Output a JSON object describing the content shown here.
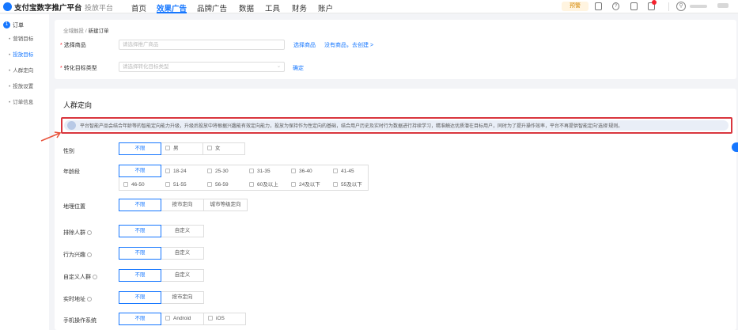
{
  "header": {
    "brand": "支付宝数字推广平台",
    "brand_sub": "投放平台",
    "nav": [
      "首页",
      "效果广告",
      "品牌广告",
      "数据",
      "工具",
      "财务",
      "账户"
    ],
    "active_nav": "效果广告",
    "warn_button": "预警",
    "accent": "#1677ff"
  },
  "sidebar": {
    "step_number": "1",
    "step_title": "订单",
    "items": [
      "营销目标",
      "投放目标",
      "人群定向",
      "投放设置",
      "订单信息"
    ],
    "active_item": "投放目标"
  },
  "breadcrumb": {
    "parent": "全域触投",
    "separator": "/",
    "current": "新建订单"
  },
  "product_form": {
    "product_label": "选择商品",
    "product_placeholder": "请选择推广商品",
    "select_product_link": "选择商品",
    "no_product_link": "没有商品，去创建 >",
    "conversion_label": "转化目标类型",
    "conversion_placeholder": "请选择转化目标类型",
    "conversion_link": "确定"
  },
  "audience": {
    "section_title": "人群定向",
    "notice": "平台智能产品会结合年龄等的智能定向能力升级，升级后投放中将根据兴趣能有效定向能力，投放为保持作为性定向的基础，结合用户历史及实时行为数据进行持续学习，精准触达优质潜在目标用户，同时为了提升操作效率，平台不再提供智能定向'选择'规则。",
    "gender": {
      "label": "性别",
      "options": [
        "不限",
        "男",
        "女"
      ],
      "selected": "不限"
    },
    "age": {
      "label": "年龄段",
      "unlimited": "不限",
      "options": [
        "18-24",
        "25-30",
        "31-35",
        "36-40",
        "41-45",
        "46-50",
        "51-55",
        "56-59",
        "60及以上",
        "24及以下",
        "55及以下"
      ],
      "selected": "不限"
    },
    "region": {
      "label": "地理位置",
      "options": [
        "不限",
        "按市定向",
        "城市等级定向"
      ],
      "selected": "不限"
    },
    "exclude": {
      "label": "排除人群",
      "options": [
        "不限",
        "自定义"
      ],
      "selected": "不限"
    },
    "interest": {
      "label": "行为兴趣",
      "options": [
        "不限",
        "自定义"
      ],
      "selected": "不限"
    },
    "custom": {
      "label": "自定义人群",
      "options": [
        "不限",
        "自定义"
      ],
      "selected": "不限"
    },
    "realtime_location": {
      "label": "实时地址",
      "options": [
        "不限",
        "按市定向"
      ],
      "selected": "不限"
    },
    "os": {
      "label": "手机操作系统",
      "options": [
        "不限",
        "Android",
        "iOS"
      ],
      "selected": "不限"
    }
  }
}
